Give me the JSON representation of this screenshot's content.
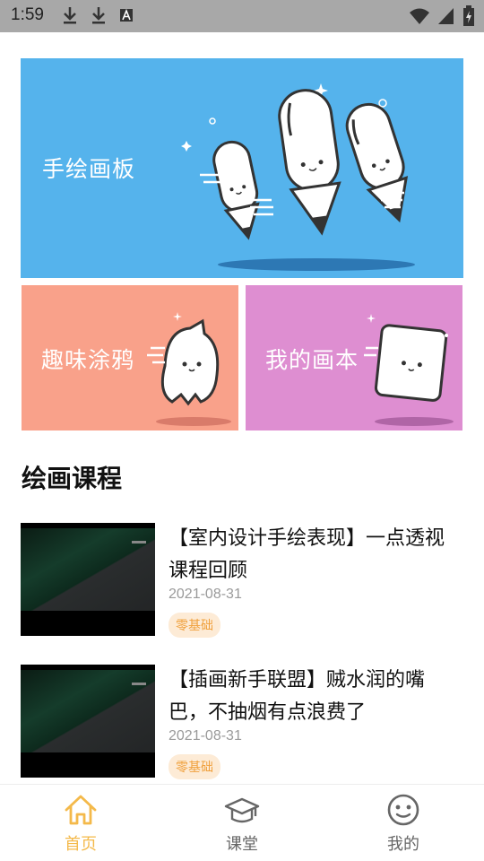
{
  "status_bar": {
    "time": "1:59",
    "left_icons": [
      "download-icon",
      "download-icon",
      "a-text-icon"
    ],
    "right_icons": [
      "wifi-icon",
      "signal-icon",
      "battery-charging-icon"
    ]
  },
  "banners": {
    "main": {
      "label": "手绘画板",
      "color": "#55b3ec"
    },
    "left": {
      "label": "趣味涂鸦",
      "color": "#f9a18a"
    },
    "right": {
      "label": "我的画本",
      "color": "#de8ed1"
    }
  },
  "section": {
    "title": "绘画课程"
  },
  "courses": [
    {
      "title": "【室内设计手绘表现】一点透视课程回顾",
      "date": "2021-08-31",
      "tag": "零基础"
    },
    {
      "title": "【插画新手联盟】贼水润的嘴巴，不抽烟有点浪费了",
      "date": "2021-08-31",
      "tag": "零基础"
    }
  ],
  "bottom_nav": {
    "items": [
      {
        "label": "首页",
        "icon": "home-icon",
        "active": true
      },
      {
        "label": "课堂",
        "icon": "graduation-cap-icon",
        "active": false
      },
      {
        "label": "我的",
        "icon": "smiley-face-icon",
        "active": false
      }
    ],
    "active_color": "#f4b94a",
    "inactive_color": "#666666"
  }
}
